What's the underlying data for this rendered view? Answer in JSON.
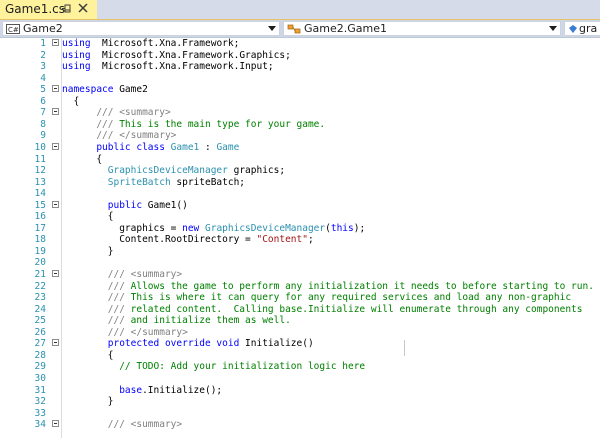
{
  "tab": {
    "title": "Game1.cs"
  },
  "navbar": {
    "project": "Game2",
    "type": "Game2.Game1",
    "member": "gra"
  },
  "editor": {
    "lines": [
      {
        "n": "1",
        "fold": true,
        "segs": [
          [
            "kw",
            "using"
          ],
          [
            "",
            "  Microsoft.Xna.Framework;"
          ]
        ]
      },
      {
        "n": "2",
        "fold": false,
        "segs": [
          [
            "kw",
            "using"
          ],
          [
            "",
            "  Microsoft.Xna.Framework.Graphics;"
          ]
        ]
      },
      {
        "n": "3",
        "fold": false,
        "segs": [
          [
            "kw",
            "using"
          ],
          [
            "",
            "  Microsoft.Xna.Framework.Input;"
          ]
        ]
      },
      {
        "n": "4",
        "fold": false,
        "segs": []
      },
      {
        "n": "5",
        "fold": true,
        "segs": [
          [
            "kw",
            "namespace"
          ],
          [
            "",
            " Game2"
          ]
        ]
      },
      {
        "n": "6",
        "fold": false,
        "segs": [
          [
            "",
            "  {"
          ]
        ]
      },
      {
        "n": "7",
        "fold": true,
        "segs": [
          [
            "cg",
            "      ///"
          ],
          [
            "cg",
            " <summary>"
          ]
        ]
      },
      {
        "n": "8",
        "fold": false,
        "segs": [
          [
            "cg",
            "      ///"
          ],
          [
            "cm",
            " This is the main type for your game."
          ]
        ]
      },
      {
        "n": "9",
        "fold": false,
        "segs": [
          [
            "cg",
            "      ///"
          ],
          [
            "cg",
            " </summary>"
          ]
        ]
      },
      {
        "n": "10",
        "fold": true,
        "segs": [
          [
            "kw",
            "      public class "
          ],
          [
            "ty",
            "Game1"
          ],
          [
            "",
            " : "
          ],
          [
            "ty",
            "Game"
          ]
        ]
      },
      {
        "n": "11",
        "fold": false,
        "segs": [
          [
            "",
            "      {"
          ]
        ]
      },
      {
        "n": "12",
        "fold": false,
        "segs": [
          [
            "ty",
            "        GraphicsDeviceManager"
          ],
          [
            "",
            " graphics;"
          ]
        ]
      },
      {
        "n": "13",
        "fold": false,
        "segs": [
          [
            "ty",
            "        SpriteBatch"
          ],
          [
            "",
            " spriteBatch;"
          ]
        ]
      },
      {
        "n": "14",
        "fold": false,
        "segs": []
      },
      {
        "n": "15",
        "fold": true,
        "segs": [
          [
            "kw",
            "        public"
          ],
          [
            "",
            " Game1()"
          ]
        ]
      },
      {
        "n": "16",
        "fold": false,
        "segs": [
          [
            "",
            "        {"
          ]
        ]
      },
      {
        "n": "17",
        "fold": false,
        "segs": [
          [
            "",
            "          graphics = "
          ],
          [
            "kw",
            "new"
          ],
          [
            "ty",
            " GraphicsDeviceManager"
          ],
          [
            "",
            "("
          ],
          [
            "kw",
            "this"
          ],
          [
            "",
            ");"
          ]
        ]
      },
      {
        "n": "18",
        "fold": false,
        "segs": [
          [
            "",
            "          Content.RootDirectory = "
          ],
          [
            "st",
            "\"Content\""
          ],
          [
            "",
            ";"
          ]
        ]
      },
      {
        "n": "19",
        "fold": false,
        "segs": [
          [
            "",
            "        }"
          ]
        ]
      },
      {
        "n": "20",
        "fold": false,
        "segs": []
      },
      {
        "n": "21",
        "fold": true,
        "segs": [
          [
            "cg",
            "        ///"
          ],
          [
            "cg",
            " <summary>"
          ]
        ]
      },
      {
        "n": "22",
        "fold": false,
        "segs": [
          [
            "cg",
            "        ///"
          ],
          [
            "cm",
            " Allows the game to perform any initialization it needs to before starting to run."
          ]
        ]
      },
      {
        "n": "23",
        "fold": false,
        "segs": [
          [
            "cg",
            "        ///"
          ],
          [
            "cm",
            " This is where it can query for any required services and load any non-graphic"
          ]
        ]
      },
      {
        "n": "24",
        "fold": false,
        "segs": [
          [
            "cg",
            "        ///"
          ],
          [
            "cm",
            " related content.  Calling base.Initialize will enumerate through any components"
          ]
        ]
      },
      {
        "n": "25",
        "fold": false,
        "segs": [
          [
            "cg",
            "        ///"
          ],
          [
            "cm",
            " and initialize them as well."
          ]
        ]
      },
      {
        "n": "26",
        "fold": false,
        "segs": [
          [
            "cg",
            "        ///"
          ],
          [
            "cg",
            " </summary>"
          ]
        ]
      },
      {
        "n": "27",
        "fold": true,
        "segs": [
          [
            "kw",
            "        protected override void"
          ],
          [
            "",
            " Initialize()"
          ]
        ]
      },
      {
        "n": "28",
        "fold": false,
        "segs": [
          [
            "",
            "        {"
          ]
        ]
      },
      {
        "n": "29",
        "fold": false,
        "segs": [
          [
            "cm",
            "          // TODO: Add your initialization logic here"
          ]
        ]
      },
      {
        "n": "30",
        "fold": false,
        "segs": []
      },
      {
        "n": "31",
        "fold": false,
        "segs": [
          [
            "kw",
            "          base"
          ],
          [
            "",
            ".Initialize();"
          ]
        ]
      },
      {
        "n": "32",
        "fold": false,
        "segs": [
          [
            "",
            "        }"
          ]
        ]
      },
      {
        "n": "33",
        "fold": false,
        "segs": []
      },
      {
        "n": "34",
        "fold": true,
        "segs": [
          [
            "cg",
            "        ///"
          ],
          [
            "cg",
            " <summary>"
          ]
        ]
      }
    ]
  }
}
